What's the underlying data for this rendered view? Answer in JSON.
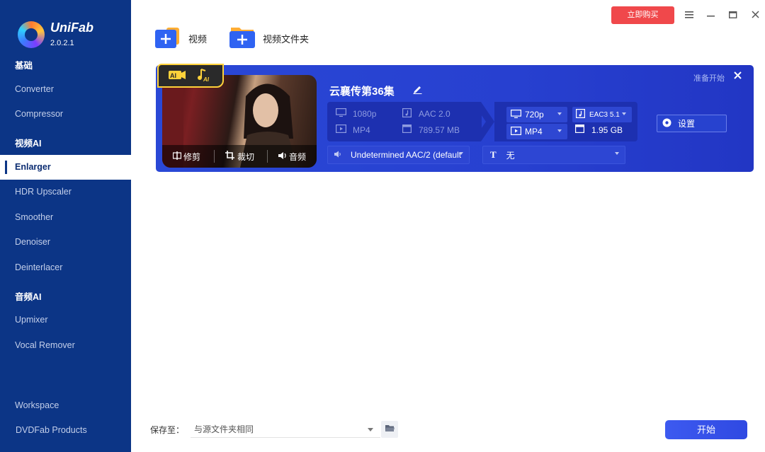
{
  "brand": {
    "name": "UniFab",
    "version": "2.0.2.1"
  },
  "sidebar": {
    "sections": [
      {
        "label": "基础"
      },
      {
        "label": "视频AI"
      },
      {
        "label": "音频AI"
      }
    ],
    "items": [
      {
        "label": "Converter"
      },
      {
        "label": "Compressor"
      },
      {
        "label": "Enlarger",
        "active": true
      },
      {
        "label": "HDR Upscaler"
      },
      {
        "label": "Smoother"
      },
      {
        "label": "Denoiser"
      },
      {
        "label": "Deinterlacer"
      },
      {
        "label": "Upmixer"
      },
      {
        "label": "Vocal Remover"
      },
      {
        "label": "Workspace"
      },
      {
        "label": "DVDFab Products"
      }
    ]
  },
  "topbar": {
    "buy_label": "立即购买",
    "add_video_label": "视频",
    "add_folder_label": "视频文件夹"
  },
  "task": {
    "title": "云襄传第36集",
    "status": "准备开始",
    "tools": {
      "trim": "修剪",
      "crop": "裁切",
      "audio": "音频"
    },
    "source": {
      "resolution": "1080p",
      "container": "MP4",
      "audio": "AAC 2.0",
      "size": "789.57 MB"
    },
    "output": {
      "resolution": "720p",
      "container": "MP4",
      "audio": "EAC3 5.1",
      "size": "1.95 GB"
    },
    "settings_label": "设置",
    "audio_track": "Undetermined AAC/2 (default",
    "subtitle": "无"
  },
  "bottom": {
    "save_to_label": "保存至：",
    "save_to_value": "与源文件夹相同",
    "start_label": "开始"
  },
  "colors": {
    "sidebar_bg": "#0c3586",
    "task_bg": "#2a48d6",
    "buy_btn": "#f0484b",
    "start_btn": "#3d5af0",
    "ai_badge_border": "#ffd23a"
  }
}
